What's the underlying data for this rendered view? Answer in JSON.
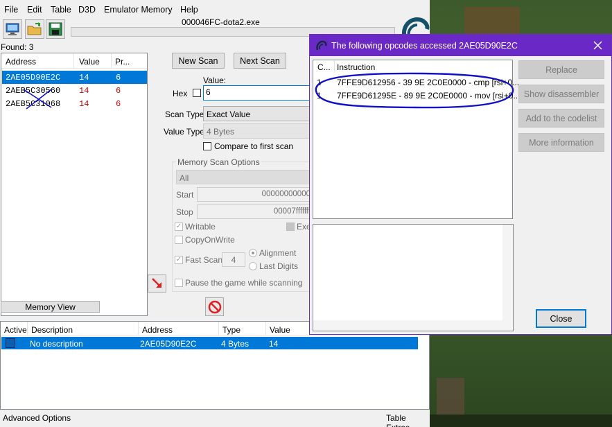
{
  "menu": [
    "File",
    "Edit",
    "Table",
    "D3D",
    "Emulator Memory",
    "Help"
  ],
  "process_title": "000046FC-dota2.exe",
  "found_label": "Found: 3",
  "results": {
    "columns": [
      "Address",
      "Value",
      "Pr..."
    ],
    "rows": [
      {
        "address": "2AE05D90E2C",
        "value": "14",
        "prev": "6",
        "selected": true
      },
      {
        "address": "2AEB5C30560",
        "value": "14",
        "prev": "6",
        "selected": false
      },
      {
        "address": "2AEB5C31068",
        "value": "14",
        "prev": "6",
        "selected": false
      }
    ]
  },
  "scan": {
    "new_scan": "New Scan",
    "next_scan": "Next Scan",
    "value_label": "Value:",
    "hex_label": "Hex",
    "value": "6",
    "scan_type_label": "Scan Type",
    "scan_type_value": "Exact Value",
    "value_type_label": "Value Type",
    "value_type_value": "4 Bytes",
    "compare_first": "Compare to first scan",
    "memory_options_title": "Memory Scan Options",
    "region_value": "All",
    "start_label": "Start",
    "start_value": "00000000000",
    "stop_label": "Stop",
    "stop_value": "00007fffffff",
    "writable": "Writable",
    "executable": "Exe",
    "copy_on_write": "CopyOnWrite",
    "fast_scan": "Fast Scan",
    "fast_scan_value": "4",
    "alignment": "Alignment",
    "last_digits": "Last Digits",
    "pause_game": "Pause the game while scanning"
  },
  "memory_view_button": "Memory View",
  "address_list": {
    "columns": [
      "Active",
      "Description",
      "Address",
      "Type",
      "Value"
    ],
    "rows": [
      {
        "description": "No description",
        "address": "2AE05D90E2C",
        "type": "4 Bytes",
        "value": "14"
      }
    ]
  },
  "footer": {
    "left": "Advanced Options",
    "right": "Table Extras"
  },
  "dialog": {
    "title": "The following opcodes accessed 2AE05D90E2C",
    "columns": [
      "C...",
      "Instruction"
    ],
    "rows": [
      {
        "count": "1",
        "instruction": "7FFE9D612956 - 39 9E 2C0E0000  - cmp [rsi+0..."
      },
      {
        "count": "1",
        "instruction": "7FFE9D61295E - 89 9E 2C0E0000  - mov [rsi+0..."
      }
    ],
    "buttons": {
      "replace": "Replace",
      "show_disassembler": "Show disassembler",
      "add_codelist": "Add to the codelist",
      "more_info": "More information",
      "close": "Close"
    }
  },
  "colors": {
    "dialog_title": "#6a28c7",
    "selection": "#0078d7",
    "value_red": "#d00000",
    "annotation_blue": "#1010c8"
  },
  "icons": [
    "computer-icon",
    "open-folder-icon",
    "save-disk-icon",
    "arrow-down-right-icon",
    "stop-icon",
    "dialog-app-icon",
    "close-icon"
  ]
}
